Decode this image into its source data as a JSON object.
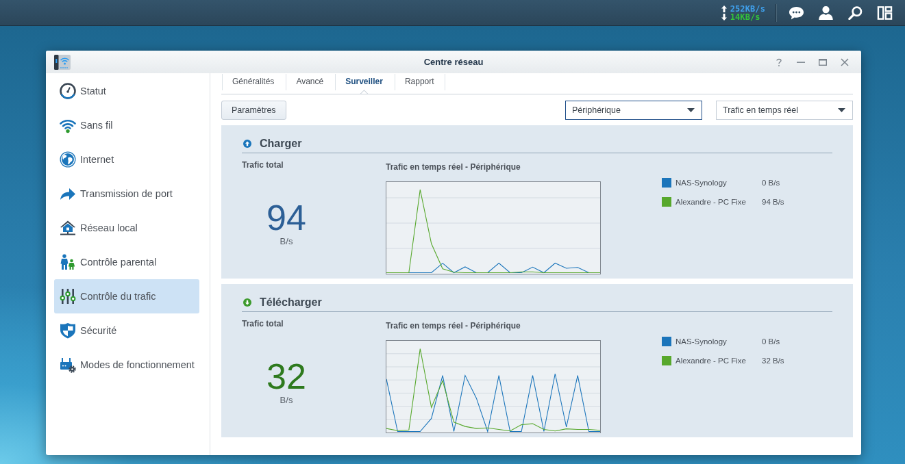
{
  "taskbar": {
    "upload_rate": "252KB/s",
    "download_rate": "14KB/s"
  },
  "window": {
    "title": "Centre réseau"
  },
  "sidebar": {
    "items": [
      {
        "label": "Statut",
        "selected": false
      },
      {
        "label": "Sans fil",
        "selected": false
      },
      {
        "label": "Internet",
        "selected": false
      },
      {
        "label": "Transmission de port",
        "selected": false
      },
      {
        "label": "Réseau local",
        "selected": false
      },
      {
        "label": "Contrôle parental",
        "selected": false
      },
      {
        "label": "Contrôle du trafic",
        "selected": true
      },
      {
        "label": "Sécurité",
        "selected": false
      },
      {
        "label": "Modes de fonctionnement",
        "selected": false
      }
    ]
  },
  "tabs": [
    {
      "label": "Généralités",
      "selected": false
    },
    {
      "label": "Avancé",
      "selected": false
    },
    {
      "label": "Surveiller",
      "selected": true
    },
    {
      "label": "Rapport",
      "selected": false
    }
  ],
  "toolbar": {
    "button": "Paramètres",
    "dropdowns": [
      {
        "value": "Périphérique",
        "focused": true
      },
      {
        "value": "Trafic en temps réel",
        "focused": false
      }
    ]
  },
  "sections": [
    {
      "kind": "upload",
      "title": "Charger",
      "total_label": "Trafic total",
      "total_value": "94",
      "total_unit": "B/s",
      "chart_title": "Trafic en temps réel - Périphérique",
      "legend": [
        {
          "name": "NAS-Synology",
          "color": "#1b75bb",
          "value": "0 B/s"
        },
        {
          "name": "Alexandre - PC Fixe",
          "color": "#57a82c",
          "value": "94 B/s"
        }
      ]
    },
    {
      "kind": "download",
      "title": "Télécharger",
      "total_label": "Trafic total",
      "total_value": "32",
      "total_unit": "B/s",
      "chart_title": "Trafic en temps réel - Périphérique",
      "legend": [
        {
          "name": "NAS-Synology",
          "color": "#1b75bb",
          "value": "0 B/s"
        },
        {
          "name": "Alexandre - PC Fixe",
          "color": "#57a82c",
          "value": "32 B/s"
        }
      ]
    }
  ]
}
